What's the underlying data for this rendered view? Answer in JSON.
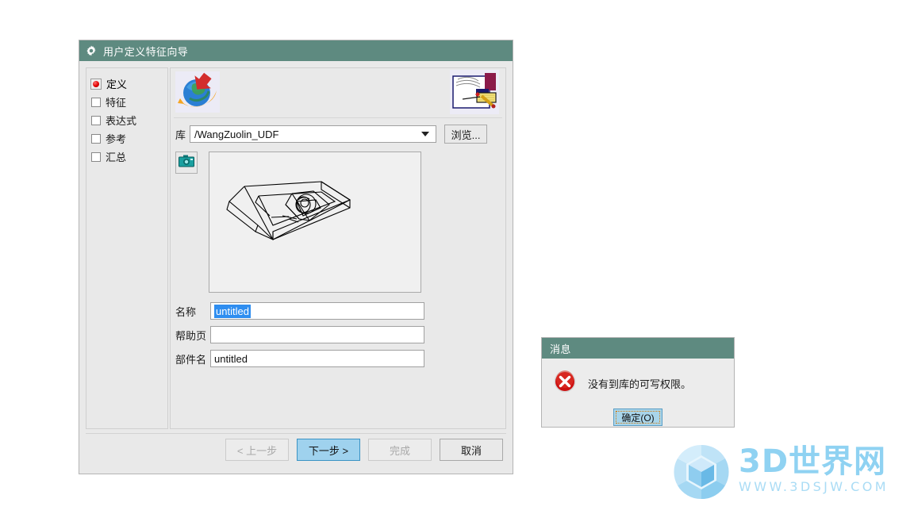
{
  "wizard": {
    "title": "用户定义特征向导",
    "title_icon": "gear-icon",
    "sidebar": {
      "items": [
        {
          "label": "定义",
          "selected": true
        },
        {
          "label": "特征",
          "selected": false
        },
        {
          "label": "表达式",
          "selected": false
        },
        {
          "label": "参考",
          "selected": false
        },
        {
          "label": "汇总",
          "selected": false
        }
      ]
    },
    "header": {
      "left_icon": "globe-wizard-icon",
      "right_icon": "hand-writing-icon"
    },
    "library": {
      "label": "库",
      "value": "/WangZuolin_UDF",
      "browse_label": "浏览..."
    },
    "preview": {
      "camera_icon": "camera-icon",
      "model_caption": ""
    },
    "fields": [
      {
        "label": "名称",
        "value": "untitled",
        "selected": true
      },
      {
        "label": "帮助页",
        "value": "",
        "selected": false
      },
      {
        "label": "部件名",
        "value": "untitled",
        "selected": false
      }
    ],
    "footer": {
      "back_label": "< 上一步",
      "next_label": "下一步 >",
      "finish_label": "完成",
      "cancel_label": "取消"
    }
  },
  "message": {
    "title": "消息",
    "icon": "error-icon",
    "text": "没有到库的可写权限。",
    "ok_label": "确定(O)"
  },
  "watermark": {
    "main": "3D世界网",
    "sub": "WWW.3DSJW.COM"
  },
  "colors": {
    "titlebar": "#5e8a80",
    "dialog_bg": "#e9e9e9",
    "primary_button": "#9fd2ee",
    "selection_blue": "#2f8ef0",
    "error_red": "#cc1111",
    "watermark_blue": "#8fd2f2"
  }
}
